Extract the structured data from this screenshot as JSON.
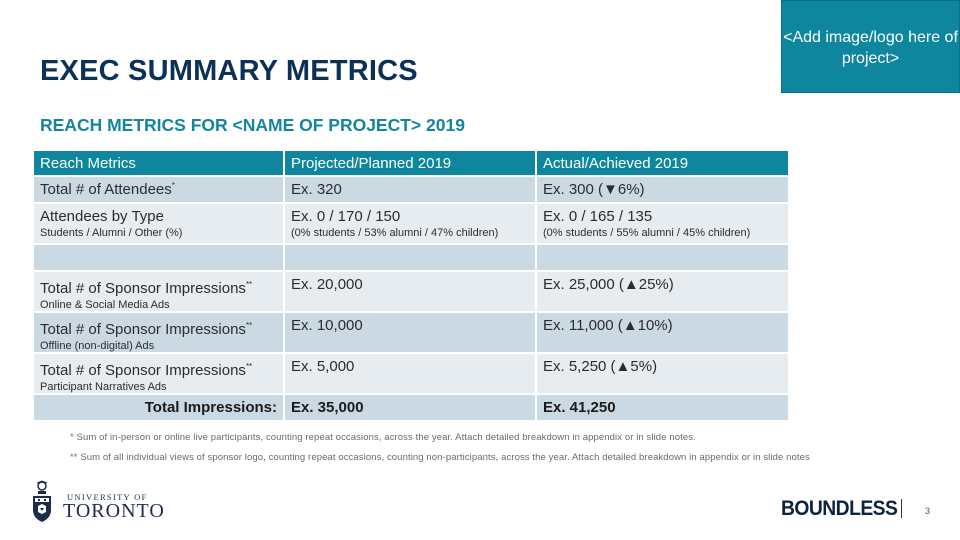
{
  "page": {
    "title": "EXEC SUMMARY METRICS",
    "subtitle": "REACH METRICS FOR <NAME OF PROJECT> 2019",
    "logo_placeholder": "<Add image/logo here of project>",
    "page_number": "3"
  },
  "table": {
    "headers": [
      "Reach Metrics",
      "Projected/Planned 2019",
      "Actual/Achieved 2019"
    ],
    "rows": [
      {
        "metric": "Total # of Attendees",
        "metric_mark": "*",
        "metric_sub": "",
        "projected": "Ex. 320",
        "projected_sub": "",
        "actual": "Ex. 300 (▼6%)",
        "actual_sub": ""
      },
      {
        "metric": "Attendees by Type",
        "metric_mark": "",
        "metric_sub": "Students / Alumni / Other (%)",
        "projected": "Ex. 0 / 170 / 150",
        "projected_sub": "(0% students / 53% alumni / 47% children)",
        "actual": "Ex. 0 / 165 / 135",
        "actual_sub": "(0% students / 55% alumni / 45% children)"
      },
      {
        "metric": "",
        "metric_mark": "",
        "metric_sub": "",
        "projected": "",
        "projected_sub": "",
        "actual": "",
        "actual_sub": ""
      },
      {
        "metric": "Total # of Sponsor Impressions",
        "metric_mark": "**",
        "metric_sub": "Online & Social Media Ads",
        "projected": "Ex. 20,000",
        "projected_sub": "",
        "actual": "Ex. 25,000 (▲25%)",
        "actual_sub": ""
      },
      {
        "metric": "Total # of Sponsor Impressions",
        "metric_mark": "**",
        "metric_sub": "Offline (non-digital) Ads",
        "projected": "Ex. 10,000",
        "projected_sub": "",
        "actual": "Ex. 11,000 (▲10%)",
        "actual_sub": ""
      },
      {
        "metric": "Total # of Sponsor Impressions",
        "metric_mark": "**",
        "metric_sub": "Participant Narratives Ads",
        "projected": "Ex. 5,000",
        "projected_sub": "",
        "actual": "Ex. 5,250 (▲5%)",
        "actual_sub": ""
      }
    ],
    "total": {
      "label": "Total Impressions:",
      "projected": "Ex. 35,000",
      "actual": "Ex. 41,250"
    }
  },
  "footnotes": [
    "* Sum of in-person or online live participants, counting repeat occasions, across the year. Attach detailed breakdown in appendix or in slide notes.",
    "** Sum of all individual views of sponsor logo, counting repeat occasions, counting non-participants, across the year. Attach detailed breakdown in appendix or in slide notes"
  ],
  "branding": {
    "university_line1": "UNIVERSITY OF",
    "university_line2": "TORONTO",
    "campaign": "BOUNDLESS"
  },
  "colors": {
    "title": "#0b3157",
    "subtitle": "#13869e",
    "accent": "#0e879e",
    "row_dark": "#cbd9e2",
    "row_light": "#e6ecf0"
  }
}
